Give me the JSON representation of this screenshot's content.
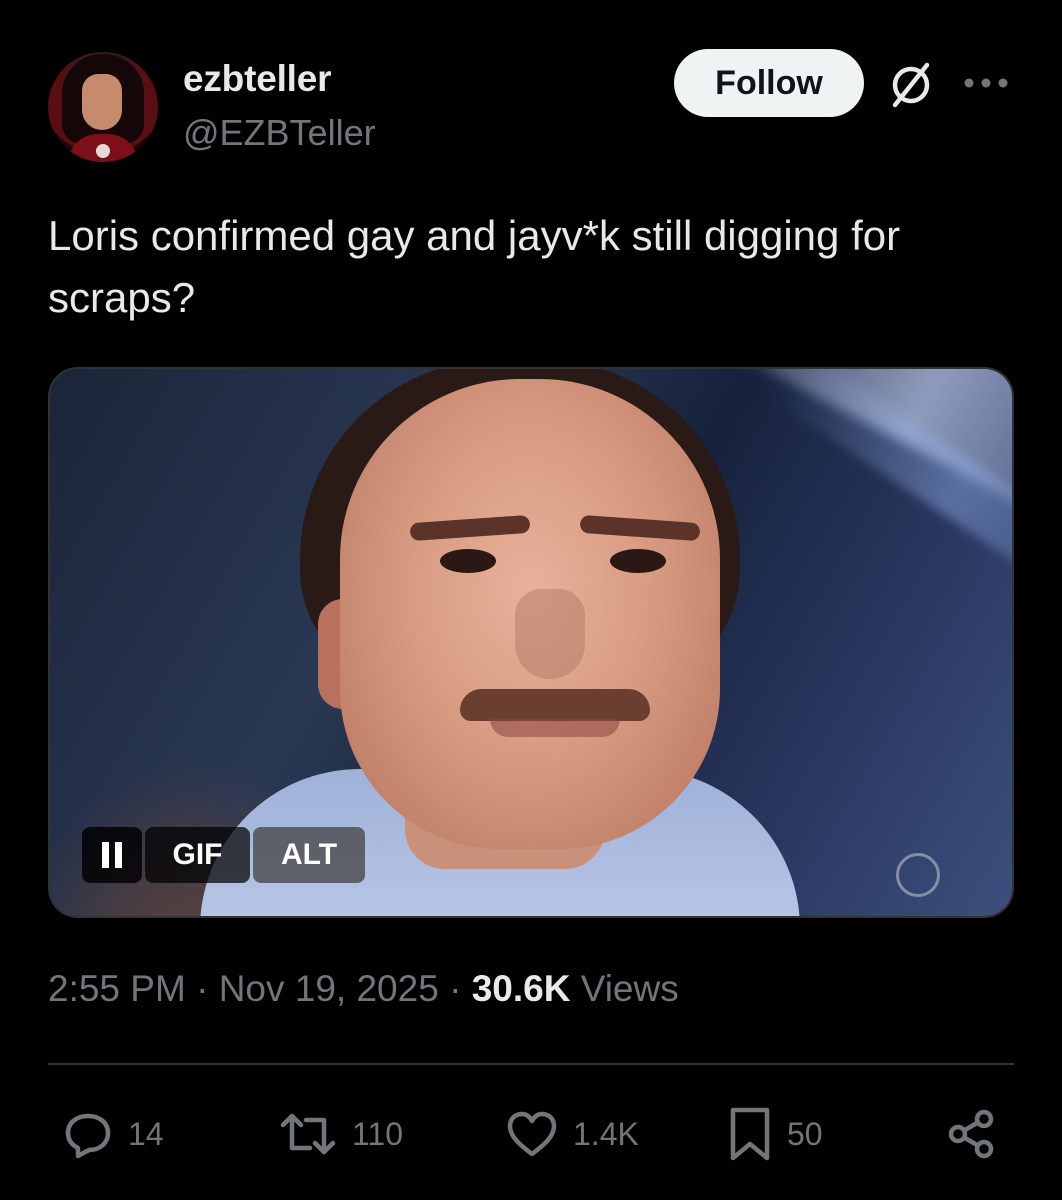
{
  "author": {
    "display_name": "ezbteller",
    "handle": "@EZBTeller",
    "follow_label": "Follow"
  },
  "tweet": {
    "text": "Loris confirmed gay and jayv*k still digging for scraps?"
  },
  "media": {
    "gif_label": "GIF",
    "alt_label": "ALT"
  },
  "meta": {
    "time": "2:55 PM",
    "separator": "·",
    "date": "Nov 19, 2025",
    "views_count": "30.6K",
    "views_label": "Views"
  },
  "actions": {
    "replies": "14",
    "retweets": "110",
    "likes": "1.4K",
    "bookmarks": "50"
  },
  "icons": {
    "grok": "grok-icon",
    "more": "more-options-icon",
    "reply": "reply-icon",
    "retweet": "retweet-icon",
    "like": "heart-icon",
    "bookmark": "bookmark-icon",
    "share": "share-icon"
  },
  "colors": {
    "background": "#000000",
    "primary_text": "#e7e9ea",
    "secondary_text": "#71767b",
    "divider": "#2f3336",
    "follow_bg": "#eff3f4"
  }
}
